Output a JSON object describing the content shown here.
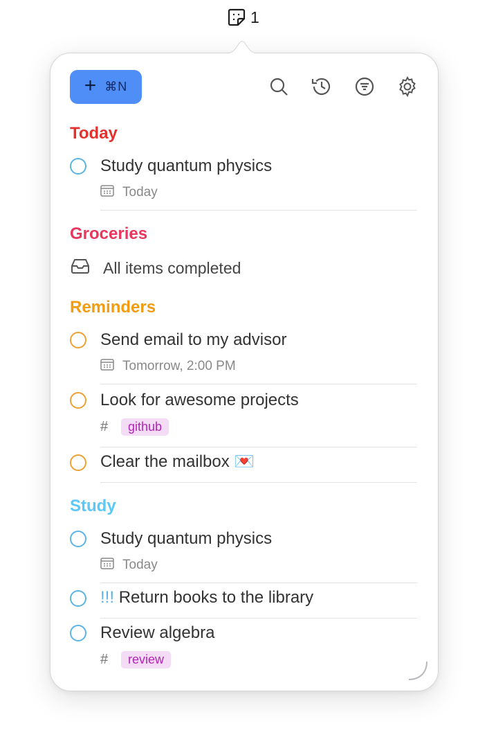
{
  "menubar": {
    "icon": "sticky-note-icon",
    "count": "1"
  },
  "toolbar": {
    "new_plus": "+",
    "new_shortcut": "⌘N",
    "icons": [
      "search-icon",
      "history-icon",
      "filter-icon",
      "gear-icon"
    ]
  },
  "sections": {
    "today": {
      "title": "Today",
      "color": "#e3322e",
      "items": [
        {
          "title": "Study quantum physics",
          "date": "Today"
        }
      ]
    },
    "groceries": {
      "title": "Groceries",
      "color": "#e8365d",
      "empty_text": "All items completed"
    },
    "reminders": {
      "title": "Reminders",
      "color": "#f39c12",
      "items": [
        {
          "title": "Send email to my advisor",
          "date": "Tomorrow, 2:00 PM"
        },
        {
          "title": "Look for awesome projects",
          "tag": "github"
        },
        {
          "title": "Clear the mailbox 💌"
        }
      ]
    },
    "study": {
      "title": "Study",
      "color": "#5ac8fa",
      "items": [
        {
          "title": "Study quantum physics",
          "date": "Today"
        },
        {
          "priority": "!!!",
          "title": "Return books to the library"
        },
        {
          "title": "Review algebra",
          "tag": "review"
        }
      ]
    }
  },
  "colors": {
    "today_check": "#5ab4e6",
    "reminder_check": "#f0a030",
    "study_check": "#5ab4e6",
    "accent": "#4f8ef6"
  }
}
